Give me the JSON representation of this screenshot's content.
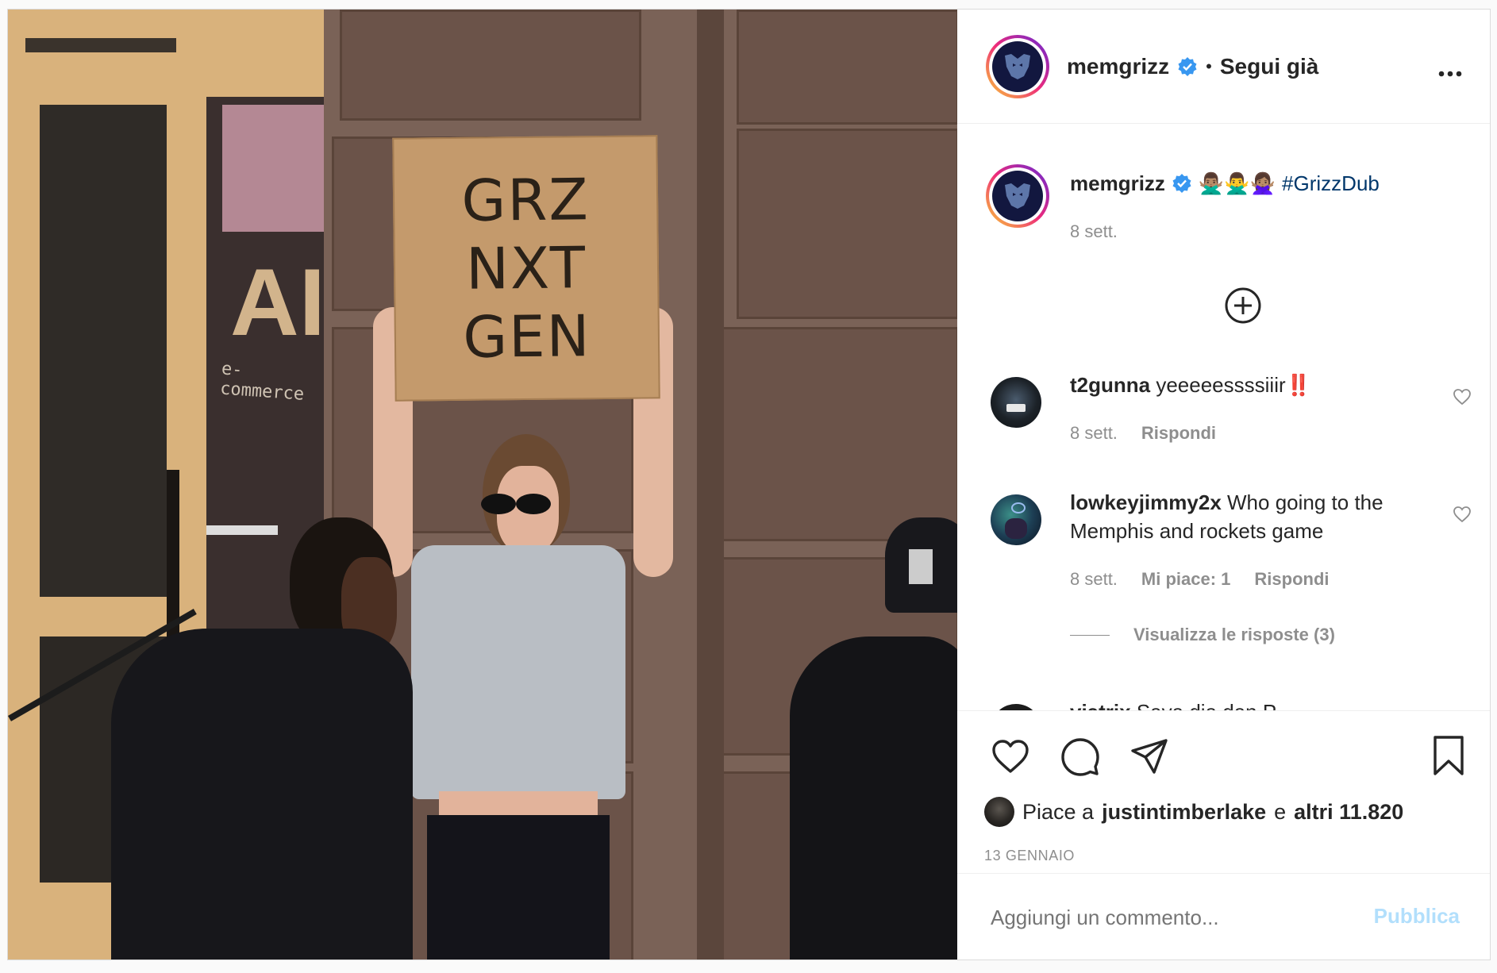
{
  "post": {
    "sign_lines": [
      "GRZ",
      "NXT",
      "GEN"
    ],
    "background_letters": "AI",
    "storefront_text": "e-commerce",
    "header": {
      "username": "memgrizz",
      "separator": "•",
      "follow_label": "Segui già",
      "more_icon": "ellipsis-icon"
    },
    "caption": {
      "username": "memgrizz",
      "emojis": "🙅🏽‍♂️🙅‍♂️🙅🏽‍♀️",
      "hashtag": "#GrizzDub",
      "time": "8 sett."
    },
    "load_more_icon": "plus-circle-icon",
    "comments": [
      {
        "username": "t2gunna",
        "text": "yeeeeessssiiir",
        "emoji": "‼️",
        "time": "8 sett.",
        "reply_label": "Rispondi"
      },
      {
        "username": "lowkeyjimmy2x",
        "text": "Who going to the Memphis and rockets game",
        "time": "8 sett.",
        "likes_label": "Mi piace: 1",
        "reply_label": "Rispondi",
        "view_replies_label": "Visualizza le risposte (3)"
      },
      {
        "username": "viatrix",
        "text": "Saya dia dan P..."
      }
    ],
    "likes": {
      "prefix": "Piace a",
      "user": "justintimberlake",
      "conjunction": "e",
      "others": "altri 11.820"
    },
    "date": "13 GENNAIO",
    "comment_input": {
      "placeholder": "Aggiungi un commento..."
    },
    "publish_label": "Pubblica",
    "colors": {
      "text": "#262626",
      "muted": "#8e8e8e",
      "verified": "#3897f0",
      "publish_disabled": "#b2dffc",
      "hashtag": "#00376b"
    }
  }
}
